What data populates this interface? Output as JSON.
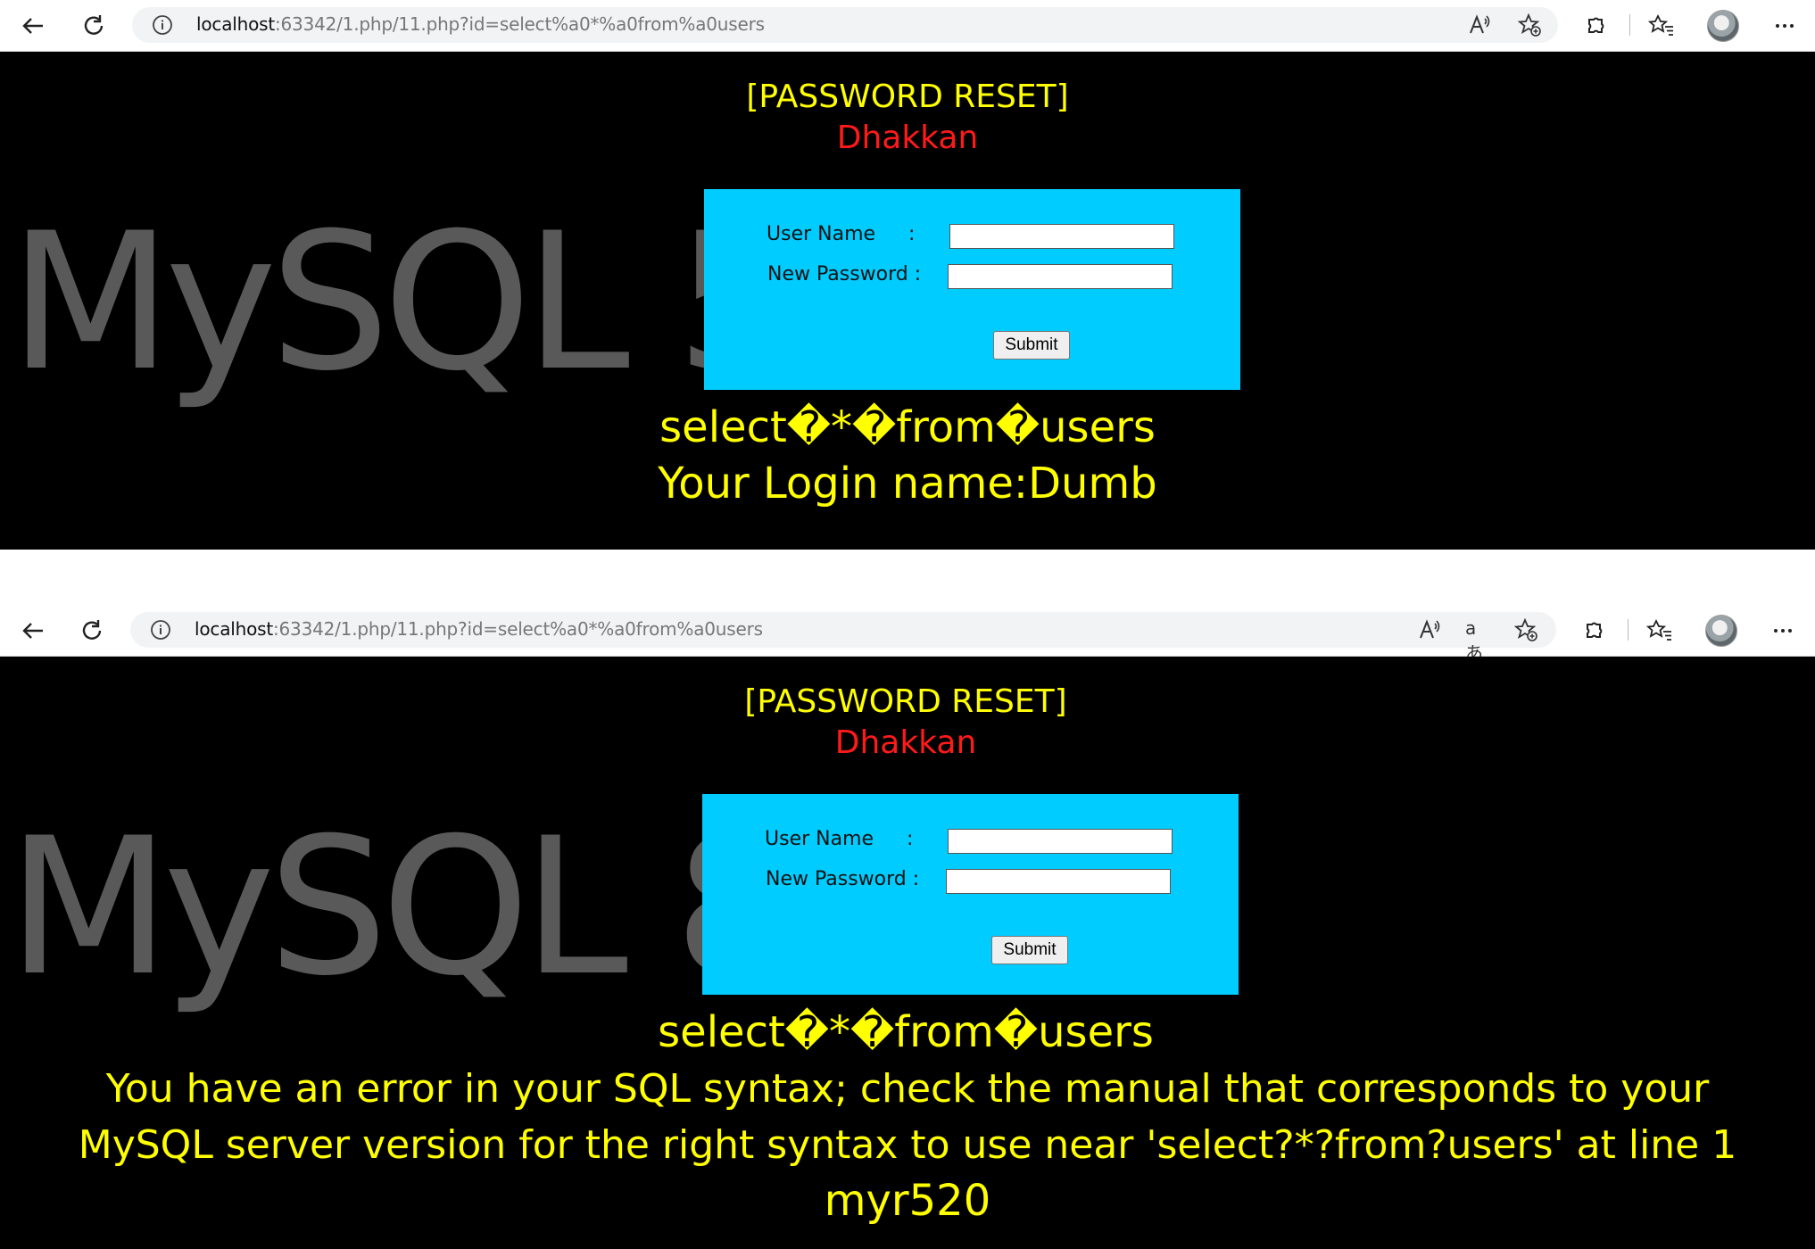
{
  "browser": {
    "url_host": "localhost",
    "url_rest": ":63342/1.php/11.php?id=select%a0*%a0from%a0users",
    "translate_icon": "aあ"
  },
  "page": {
    "title": "[PASSWORD RESET]",
    "subtitle": "Dhakkan",
    "username_label": "User Name",
    "username_colon": ":",
    "password_label": "New Password :",
    "submit_label": "Submit"
  },
  "panel1": {
    "watermark": "MySQL 5",
    "query_echo": "select�*�from�users",
    "result": "Your Login name:Dumb"
  },
  "panel2": {
    "watermark": "MySQL 8",
    "query_echo": "select�*�from�users",
    "error_line1": "You have an error in your SQL syntax; check the manual that corresponds to your",
    "error_line2": "MySQL server version for the right syntax to use near 'select?*?from?users' at line 1",
    "signature": "myr520"
  },
  "colors": {
    "page_bg": "#000000",
    "title": "#ffff00",
    "subtitle": "#ff1a1a",
    "form_bg": "#00ccff",
    "watermark": "#595959"
  }
}
